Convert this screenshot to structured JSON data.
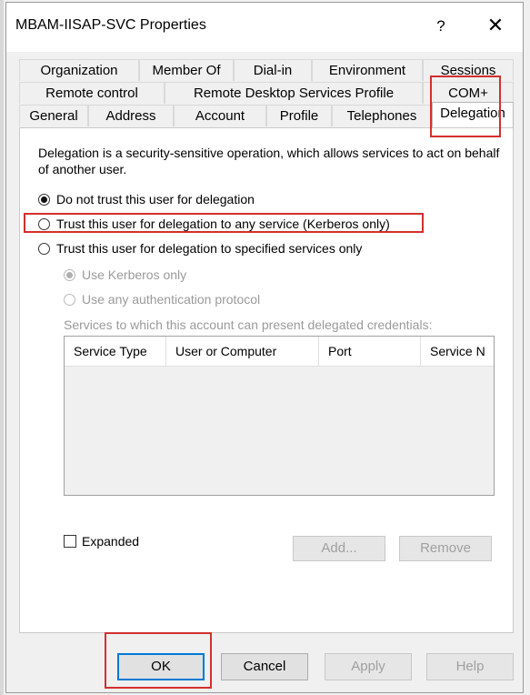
{
  "window": {
    "title": "MBAM-IISAP-SVC Properties",
    "help_glyph": "?",
    "close_glyph": "✕"
  },
  "tabs": {
    "row1": [
      "Organization",
      "Member Of",
      "Dial-in",
      "Environment",
      "Sessions"
    ],
    "row2": [
      "Remote control",
      "Remote Desktop Services Profile",
      "COM+"
    ],
    "row3": [
      "General",
      "Address",
      "Account",
      "Profile",
      "Telephones",
      "Delegation"
    ],
    "active": "Delegation"
  },
  "delegation": {
    "description": "Delegation is a security-sensitive operation, which allows services to act on behalf of another user.",
    "options": [
      {
        "label": "Do not trust this user for delegation",
        "checked": true
      },
      {
        "label": "Trust this user for delegation to any service (Kerberos only)",
        "checked": false
      },
      {
        "label": "Trust this user for delegation to specified services only",
        "checked": false
      }
    ],
    "sub_options": [
      {
        "label": "Use Kerberos only",
        "checked": true,
        "disabled": true
      },
      {
        "label": "Use any authentication protocol",
        "checked": false,
        "disabled": true
      }
    ],
    "services_caption": "Services to which this account can present delegated credentials:",
    "columns": [
      "Service Type",
      "User or Computer",
      "Port",
      "Service N"
    ],
    "expanded_label": "Expanded",
    "expanded_checked": false,
    "add_label": "Add...",
    "remove_label": "Remove"
  },
  "footer": {
    "ok": "OK",
    "cancel": "Cancel",
    "apply": "Apply",
    "help": "Help"
  },
  "colors": {
    "highlight": "#d32f2f",
    "default_button_border": "#0078d7"
  }
}
